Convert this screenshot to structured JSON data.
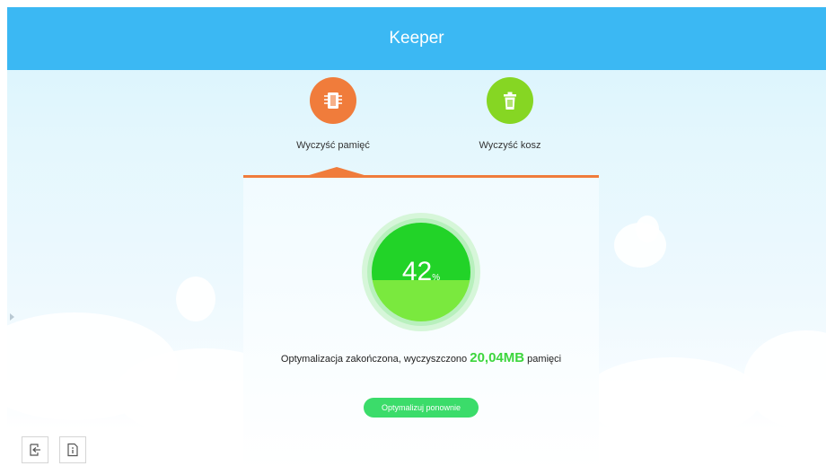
{
  "header": {
    "title": "Keeper"
  },
  "features": [
    {
      "label": "Wyczyść pamięć",
      "icon": "memory-chip-icon",
      "color": "#f07c3b"
    },
    {
      "label": "Wyczyść kosz",
      "icon": "trash-icon",
      "color": "#86d623"
    }
  ],
  "panel": {
    "active_tab_color": "#f07c3b",
    "gauge": {
      "value": "42",
      "unit": "%",
      "fraction": 0.42,
      "top_color": "#22d328",
      "fill_color": "#7ae93e"
    },
    "result": {
      "prefix": "Optymalizacja zakończona, wyczyszczono",
      "amount": "20,04MB",
      "suffix": "pamięci",
      "amount_color": "#3dd63d"
    },
    "button": {
      "label": "Optymalizuj ponownie",
      "color": "#3bdc6a"
    }
  },
  "bottom_bar": [
    {
      "icon": "exit-icon"
    },
    {
      "icon": "info-icon"
    }
  ]
}
